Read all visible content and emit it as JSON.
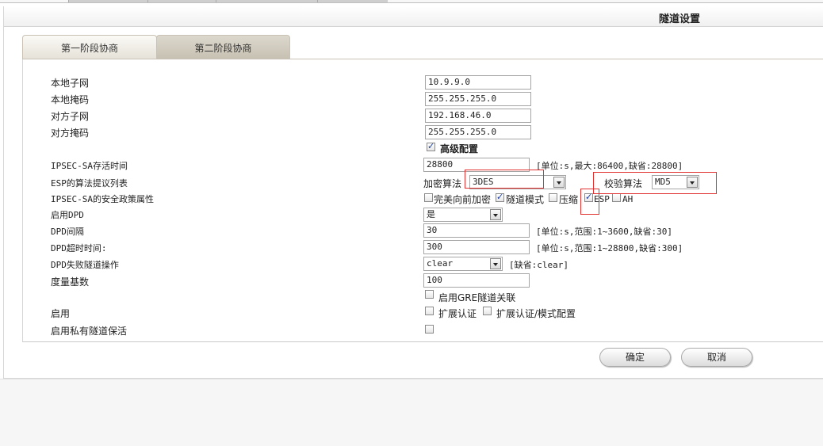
{
  "colors": {
    "accent_red": "#e03030",
    "tab_active": "#c6c0b2",
    "check_mark": "#1a3fa0"
  },
  "panel": {
    "title": "隧道设置"
  },
  "tabs": [
    {
      "label": "第一阶段协商",
      "active": false
    },
    {
      "label": "第二阶段协商",
      "active": true
    }
  ],
  "form": {
    "local_subnet": {
      "label": "本地子网",
      "value": "10.9.9.0"
    },
    "local_mask": {
      "label": "本地掩码",
      "value": "255.255.255.0"
    },
    "peer_subnet": {
      "label": "对方子网",
      "value": "192.168.46.0"
    },
    "peer_mask": {
      "label": "对方掩码",
      "value": "255.255.255.0"
    },
    "advanced": {
      "label": "高级配置",
      "checked": true
    },
    "sa_lifetime": {
      "label": "IPSEC-SA存活时间",
      "value": "28800",
      "hint": "[单位:s,最大:86400,缺省:28800]"
    },
    "esp_proposal": {
      "label": "ESP的算法提议列表",
      "enc_label": "加密算法",
      "enc_value": "3DES",
      "auth_label": "校验算法",
      "auth_value": "MD5"
    },
    "sa_policy": {
      "label": "IPSEC-SA的安全政策属性",
      "options": [
        {
          "label": "完美向前加密",
          "checked": false
        },
        {
          "label": "隧道模式",
          "checked": true
        },
        {
          "label": "压缩",
          "checked": false
        },
        {
          "label": "ESP",
          "checked": true
        },
        {
          "label": "AH",
          "checked": false
        }
      ]
    },
    "enable_dpd": {
      "label": "启用DPD",
      "value": "是"
    },
    "dpd_interval": {
      "label": "DPD间隔",
      "value": "30",
      "hint": "[单位:s,范围:1~3600,缺省:30]"
    },
    "dpd_timeout": {
      "label": "DPD超时时间:",
      "value": "300",
      "hint": "[单位:s,范围:1~28800,缺省:300]"
    },
    "dpd_action": {
      "label": "DPD失败隧道操作",
      "value": "clear",
      "hint": "[缺省:clear]"
    },
    "metric": {
      "label": "度量基数",
      "value": "100"
    },
    "gre": {
      "label": "启用GRE隧道关联",
      "checked": false
    },
    "enable": {
      "label": "启用",
      "ext_auth_label": "扩展认证",
      "ext_mode_label": "扩展认证/模式配置"
    },
    "keepalive": {
      "label": "启用私有隧道保活",
      "checked": false
    }
  },
  "buttons": {
    "ok": "确定",
    "cancel": "取消"
  }
}
